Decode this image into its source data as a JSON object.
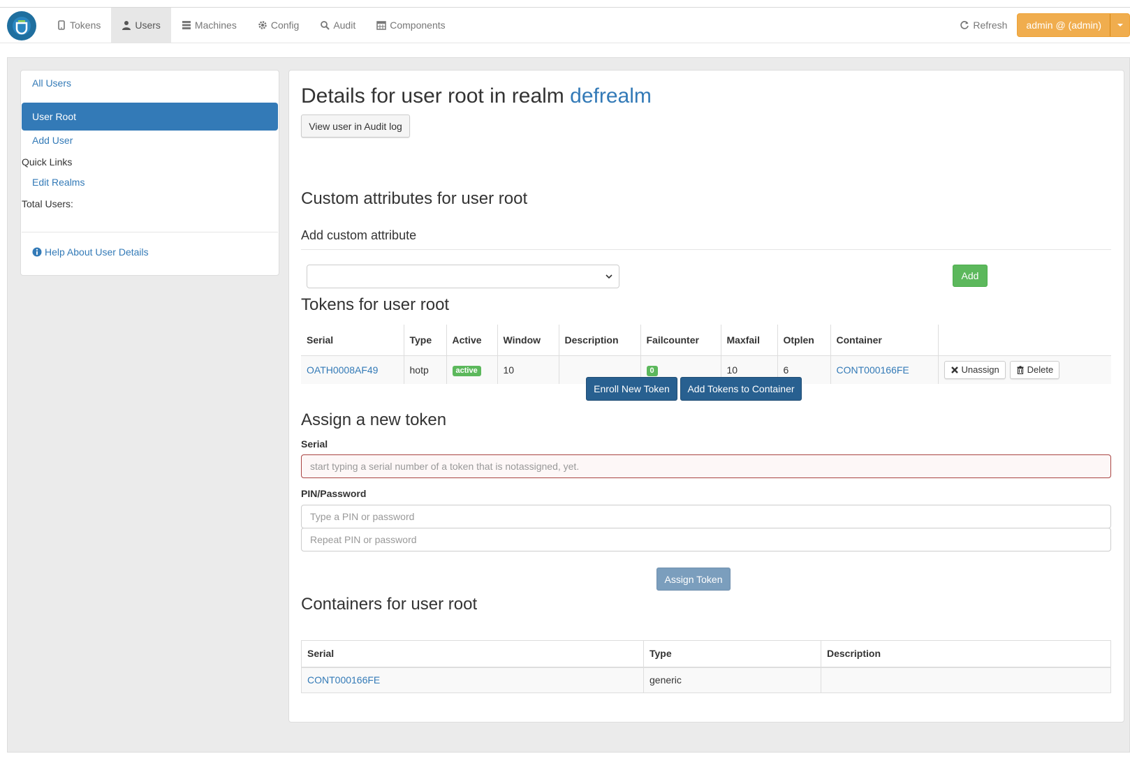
{
  "nav": {
    "items": [
      {
        "label": "Tokens",
        "icon": "phone-icon"
      },
      {
        "label": "Users",
        "icon": "user-icon"
      },
      {
        "label": "Machines",
        "icon": "server-icon"
      },
      {
        "label": "Config",
        "icon": "gear-icon"
      },
      {
        "label": "Audit",
        "icon": "search-icon"
      },
      {
        "label": "Components",
        "icon": "calendar-icon"
      }
    ],
    "active": "Users",
    "refresh_label": "Refresh",
    "admin_label": "admin @ (admin)"
  },
  "sidebar": {
    "all_users": "All Users",
    "user_root": "User Root",
    "add_user": "Add User",
    "quick_links": "Quick Links",
    "edit_realms": "Edit Realms",
    "total_users": "Total Users:",
    "help": "Help About User Details"
  },
  "main": {
    "title_prefix": "Details for user root in realm",
    "realm": "defrealm",
    "audit_button": "View user in Audit log",
    "custom_attr_heading": "Custom attributes for user root",
    "add_custom_attr": "Add custom attribute",
    "add_button": "Add",
    "tokens_heading": "Tokens for user root",
    "tokens_table": {
      "headers": [
        "Serial",
        "Type",
        "Active",
        "Window",
        "Description",
        "Failcounter",
        "Maxfail",
        "Otplen",
        "Container",
        ""
      ],
      "rows": [
        {
          "serial": "OATH0008AF49",
          "type": "hotp",
          "active": "active",
          "window": "10",
          "description": "",
          "failcounter": "0",
          "maxfail": "10",
          "otplen": "6",
          "container": "CONT000166FE",
          "unassign": "Unassign",
          "delete": "Delete"
        }
      ]
    },
    "enroll_button": "Enroll New Token",
    "add_to_container_button": "Add Tokens to Container",
    "assign_heading": "Assign a new token",
    "serial_label": "Serial",
    "serial_placeholder": "start typing a serial number of a token that is notassigned, yet.",
    "pin_label": "PIN/Password",
    "pin_placeholder": "Type a PIN or password",
    "pin_repeat_placeholder": "Repeat PIN or password",
    "assign_button": "Assign Token",
    "containers_heading": "Containers for user root",
    "containers_table": {
      "headers": [
        "Serial",
        "Type",
        "Description"
      ],
      "rows": [
        {
          "serial": "CONT000166FE",
          "type": "generic",
          "description": ""
        }
      ]
    }
  },
  "colors": {
    "primary": "#337ab7",
    "admin": "#f0ad4e",
    "success": "#5cb85c",
    "dark_primary": "#286090"
  }
}
